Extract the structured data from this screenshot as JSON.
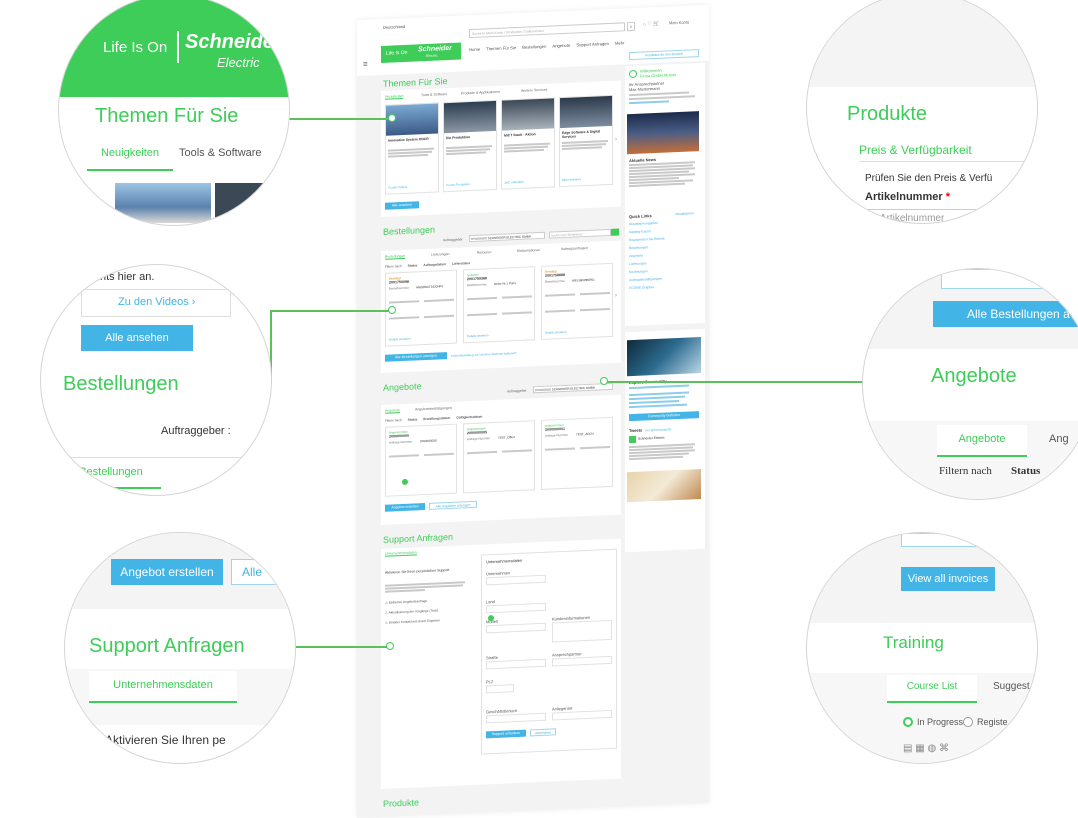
{
  "left_callouts": {
    "header": {
      "tagline": "Life Is On",
      "brand": "Schneider",
      "brand_sub": "Electric",
      "section_title": "Themen Für Sie",
      "tabs": [
        "Neuigkeiten",
        "Tools & Software"
      ]
    },
    "orders": {
      "events_text": "Events hier an.",
      "videos_link": "Zu den Videos",
      "view_all": "Alle ansehen",
      "section_title": "Bestellungen",
      "client_label": "Auftraggeber :",
      "tab": "Bestellungen"
    },
    "support": {
      "create_offer": "Angebot erstellen",
      "all_label": "Alle",
      "section_title": "Support Anfragen",
      "tab": "Unternehmensdaten",
      "activate_text": "Aktivieren Sie Ihren pe"
    }
  },
  "right_callouts": {
    "products": {
      "section_title": "Produkte",
      "subtitle": "Preis & Verfügbarkeit",
      "check_text": "Prüfen Sie den Preis & Verfü",
      "field_label": "Artikelnummer",
      "required": "*",
      "input_placeholder": "Artikelnummer"
    },
    "offers": {
      "all_orders_btn": "Alle Bestellungen a",
      "section_title": "Angebote",
      "tabs": [
        "Angebote",
        "Ang"
      ],
      "filter_label": "Filtern nach",
      "status_label": "Status"
    },
    "training": {
      "invoices_btn": "View all invoices",
      "section_title": "Training",
      "tabs": [
        "Course List",
        "Suggest"
      ],
      "radios": [
        "In Progress",
        "Registe"
      ]
    }
  },
  "mockup": {
    "topbar": {
      "country": "Deutschland",
      "search_placeholder": "Suche in Mein Konto / Produkten / Dokumenten",
      "user": "Mein Konto"
    },
    "logo_tagline": "Life Is On",
    "logo_brand": "Schneider",
    "logo_sub": "Electric",
    "nav": [
      "Home",
      "Themen Für Sie",
      "Bestellungen",
      "Angebote",
      "Support Anfragen",
      "Mehr"
    ],
    "feedback_btn": "Feedback für den Bereich",
    "themen": {
      "title": "Themen Für Sie",
      "tabs": [
        "Neuigkeiten",
        "Tools & Software",
        "Produkte & Applikationen",
        "Weitere Services"
      ],
      "cards": [
        {
          "title": "Innovative System ONCR",
          "link": "Zu den Videos"
        },
        {
          "title": "Die Produktion",
          "link": "Zu den Produkten"
        },
        {
          "title": "MiCT Stack - Aktion",
          "link": "Jetzt anfordern"
        },
        {
          "title": "Edge Software & Digital Services",
          "link": "Mehr erfahren"
        }
      ],
      "view_all": "Alle ansehen"
    },
    "profile": {
      "title": "Willkommen",
      "name": "Firma GmbH Muster",
      "role": "Ihr Ansprechpartner",
      "contact": "Max Mustermann"
    },
    "news": {
      "title": "Aktuelle News"
    },
    "bestellungen": {
      "title": "Bestellungen",
      "client_label": "Auftraggeber",
      "client_value": "XYXXXXXX SCHNEIDER ELECTRIC GMBH",
      "search_placeholder": "Suche nach Bestellung",
      "tabs": [
        "Bestellungen",
        "Lieferungen",
        "Retouren",
        "Reklamationen",
        "Auftragsanfragen"
      ],
      "filter_label": "Filtern nach",
      "filters": [
        "Status",
        "Auftragsdatum",
        "Lieferstatus"
      ],
      "orders": [
        {
          "status": "Bestätigt",
          "number": "2001750098",
          "order_label": "Bestellnummer",
          "order_no": "ANGEBOT2020NR1"
        },
        {
          "status": "Geliefert",
          "number": "2001759368",
          "order_label": "Bestellnummer",
          "order_no": "Order Nr.1 Ports"
        },
        {
          "status": "Bestätigt",
          "number": "2001758888",
          "order_label": "Bestellnummer",
          "order_no": "WELS8028NR01"
        }
      ],
      "details_link": "Details ansehen",
      "all_orders_btn": "Alle Bestellungen anzeigen",
      "note": "Keine Bestellung zur Nummer-Nummer bekannt?"
    },
    "quick_links": {
      "title": "Quick Links",
      "more": "Aktualisieren",
      "items": [
        "Aktualisierungsplan",
        "Katalog-Export",
        "Registrierten Sie Betrieb",
        "Bestellungen",
        "Angebote",
        "Lieferungen",
        "Rechnungen",
        "Auftragsbestätigungen",
        "PCOME Zeitplan"
      ]
    },
    "angebote": {
      "title": "Angebote",
      "client_label": "Auftraggeber",
      "client_value": "XYXXXXXX SCHNEIDER ELECTRIC GMBH",
      "tabs": [
        "Angebote",
        "Angebotsbestätigungen"
      ],
      "filter_label": "Filtern nach",
      "filters": [
        "Status",
        "Erstellungsdatum",
        "Gültigkeitsdatum"
      ],
      "offers": [
        {
          "status": "Angenommen",
          "number": "2000000000",
          "label": "Anfrage-Nummer",
          "value": "2000000000"
        },
        {
          "status": "Angenommen",
          "number": "2000000005",
          "label": "Anfrage-Nummer",
          "value": "TEST_Offert"
        },
        {
          "status": "Angenommen",
          "number": "2000000001",
          "label": "Anfrage-Nummer",
          "value": "TEST_AFCN"
        }
      ],
      "create_btn": "Angebot erstellen",
      "all_btn": "Alle Angebote anzeigen"
    },
    "community": {
      "title": "Explore Community",
      "join_btn": "Community beitreten"
    },
    "tweets": {
      "title": "Tweets",
      "handle": "von @SchneiderDE",
      "author": "Schneider Electric"
    },
    "support": {
      "title": "Support Anfragen",
      "tab": "Unternehmensdaten",
      "activate": "Aktivieren Sie Ihren persönlichen Support",
      "options": [
        "Einfacher Angebotsanfrage",
        "Aktualisierung der Vorgänge (Tech)",
        "Direkter Kontakt mit einem Experten"
      ],
      "form_title": "Unternehmensdaten",
      "fields": [
        "Unternehmen",
        "Land",
        "Modell",
        "Kundeninformationen",
        "Beschreibung",
        "Straße",
        "Ansprechpartner",
        "PLZ",
        "Geschäftsbereich",
        "Anliegenart"
      ],
      "submit": "Support anfordern",
      "reset": "Abbrechen"
    },
    "produkte_title": "Produkte"
  }
}
